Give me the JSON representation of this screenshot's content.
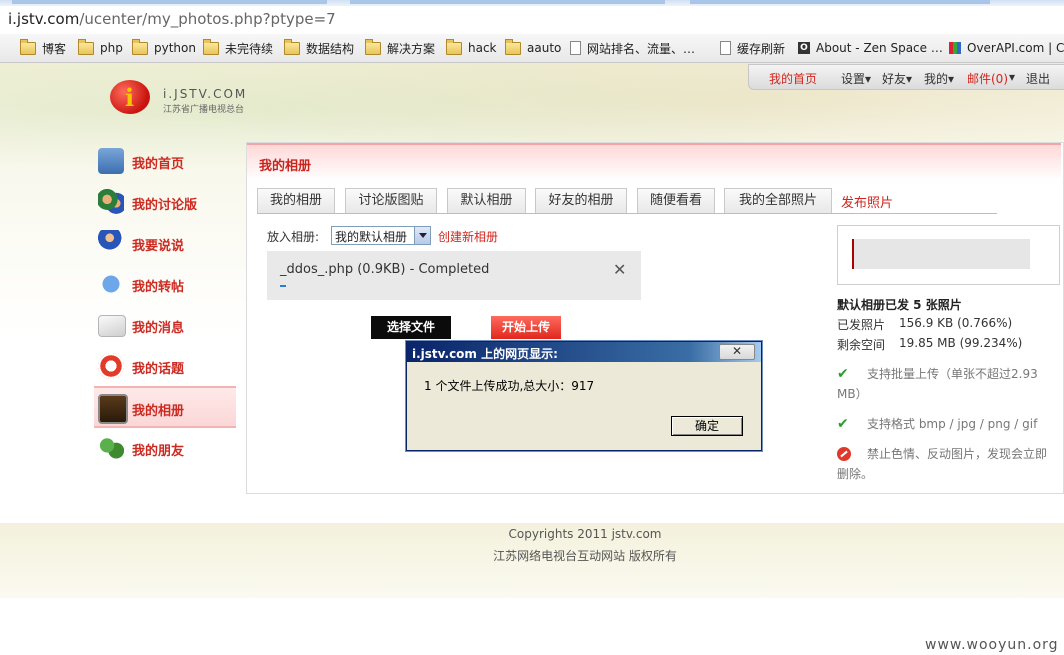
{
  "browser": {
    "url_host": "i.jstv.com",
    "url_path": "/ucenter/my_photos.php?ptype=7",
    "bookmarks": [
      {
        "label": "博客",
        "icon": "folder-icon"
      },
      {
        "label": "php",
        "icon": "folder-icon"
      },
      {
        "label": "python",
        "icon": "folder-icon"
      },
      {
        "label": "未完待续",
        "icon": "folder-icon"
      },
      {
        "label": "数据结构",
        "icon": "folder-icon"
      },
      {
        "label": "解决方案",
        "icon": "folder-icon"
      },
      {
        "label": "hack",
        "icon": "folder-icon"
      },
      {
        "label": "aauto",
        "icon": "folder-icon"
      },
      {
        "label": "网站排名、流量、…",
        "icon": "page-icon"
      },
      {
        "label": "缓存刷新",
        "icon": "page-icon"
      },
      {
        "label": "About - Zen Space …",
        "icon": "zen-icon"
      },
      {
        "label": "OverAPI.com | Coll",
        "icon": "overapi-icon"
      }
    ]
  },
  "logo": {
    "line1": "i.JSTV.COM",
    "line2": "江苏省广播电视总台"
  },
  "userbar": {
    "home": "我的首页",
    "settings": "设置▾",
    "friends": "好友▾",
    "mine": "我的▾",
    "mail": "邮件(0)",
    "mail_caret": "▾",
    "logout": "退出"
  },
  "nav": [
    {
      "label": "我的首页",
      "icon": "home-icon"
    },
    {
      "label": "我的讨论版",
      "icon": "users-icon"
    },
    {
      "label": "我要说说",
      "icon": "person-pen-icon"
    },
    {
      "label": "我的转帖",
      "icon": "chat-bubble-icon"
    },
    {
      "label": "我的消息",
      "icon": "envelope-icon"
    },
    {
      "label": "我的话题",
      "icon": "lifebuoy-icon"
    },
    {
      "label": "我的相册",
      "icon": "photo-album-icon"
    },
    {
      "label": "我的朋友",
      "icon": "friends-icon"
    }
  ],
  "panel": {
    "title": "我的相册",
    "tabs": [
      "我的相册",
      "讨论版图贴",
      "默认相册",
      "好友的相册",
      "随便看看",
      "我的全部照片"
    ],
    "publish": "发布照片",
    "put_label": "放入相册:",
    "album_selected": "我的默认相册",
    "create_album": "创建新相册",
    "file": {
      "name": "_ddos_.php (0.9KB) - Completed",
      "close": "✕",
      "progress": 0.02
    },
    "choose_btn": "选择文件",
    "upload_btn": "开始上传"
  },
  "info": {
    "title": "默认相册已发 5 张照片",
    "sent_label": "已发照片",
    "sent_value": "156.9 KB  (0.766%)",
    "left_label": "剩余空间",
    "left_value": "19.85 MB  (99.234%)",
    "features": [
      {
        "icon": "check-icon",
        "text": "支持批量上传（单张不超过2.93 MB）"
      },
      {
        "icon": "check-icon",
        "text": "支持格式 bmp / jpg / png / gif"
      },
      {
        "icon": "ban-icon",
        "text": "禁止色情、反动图片，发现会立即删除。"
      }
    ]
  },
  "dialog": {
    "title": "i.jstv.com 上的网页显示:",
    "close": "✕",
    "message": "1 个文件上传成功,总大小：917",
    "ok": "确定"
  },
  "footer": {
    "line1": "Copyrights 2011 jstv.com",
    "line2": "江苏网络电视台互动网站 版权所有"
  },
  "watermark": "www.wooyun.org"
}
